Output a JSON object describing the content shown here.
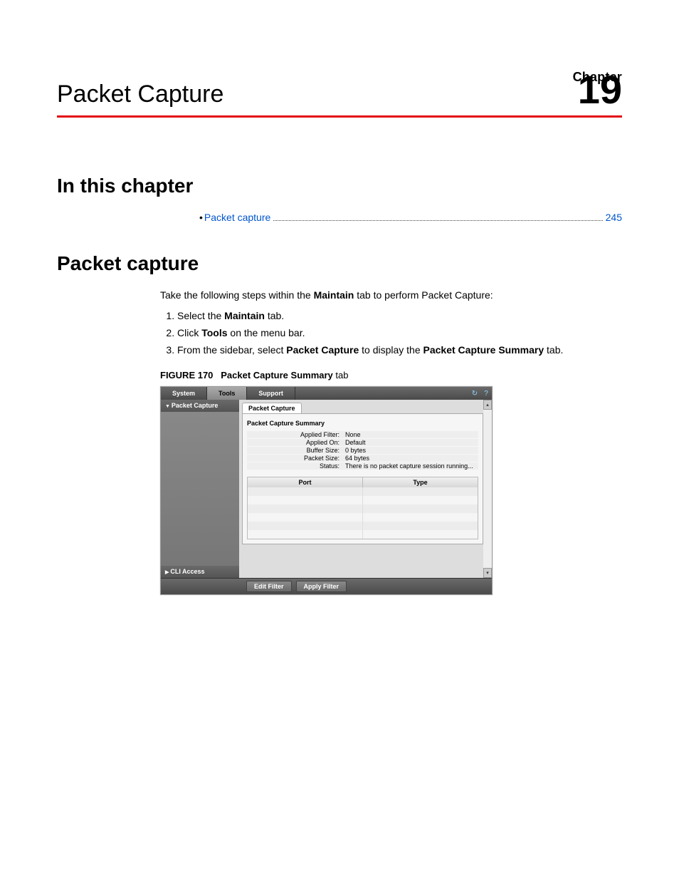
{
  "chapter": {
    "label": "Chapter",
    "number": "19",
    "title": "Packet Capture"
  },
  "sections": {
    "in_this_chapter": "In this chapter",
    "packet_capture": "Packet capture"
  },
  "toc": {
    "item": "Packet capture",
    "page": "245"
  },
  "intro": {
    "prefix": "Take the following steps within the ",
    "bold1": "Maintain",
    "suffix": " tab to perform Packet Capture:"
  },
  "steps": [
    {
      "pre": "Select the ",
      "b": "Maintain",
      "post": " tab."
    },
    {
      "pre": "Click ",
      "b": "Tools",
      "post": " on the menu bar."
    },
    {
      "pre": "From the sidebar, select ",
      "b": "Packet Capture",
      "mid": " to display the ",
      "b2": "Packet Capture Summary",
      "post": " tab."
    }
  ],
  "figure": {
    "label": "FIGURE 170",
    "title_bold": "Packet Capture Summary",
    "title_rest": " tab"
  },
  "screenshot": {
    "menus": {
      "system": "System",
      "tools": "Tools",
      "support": "Support"
    },
    "icons": {
      "refresh": "↻",
      "help": "?"
    },
    "sidebar": {
      "packet_capture": "Packet Capture",
      "cli_access": "CLI Access"
    },
    "tab": "Packet Capture",
    "panel_title": "Packet Capture Summary",
    "rows": {
      "applied_filter": {
        "k": "Applied Filter:",
        "v": "None"
      },
      "applied_on": {
        "k": "Applied On:",
        "v": "Default"
      },
      "buffer_size": {
        "k": "Buffer Size:",
        "v": "0 bytes"
      },
      "packet_size": {
        "k": "Packet Size:",
        "v": "64 bytes"
      },
      "status": {
        "k": "Status:",
        "v": "There is no packet capture session running..."
      }
    },
    "table": {
      "port": "Port",
      "type": "Type"
    },
    "buttons": {
      "edit_filter": "Edit Filter",
      "apply_filter": "Apply Filter"
    },
    "scroll": {
      "up": "▴",
      "down": "▾"
    }
  }
}
